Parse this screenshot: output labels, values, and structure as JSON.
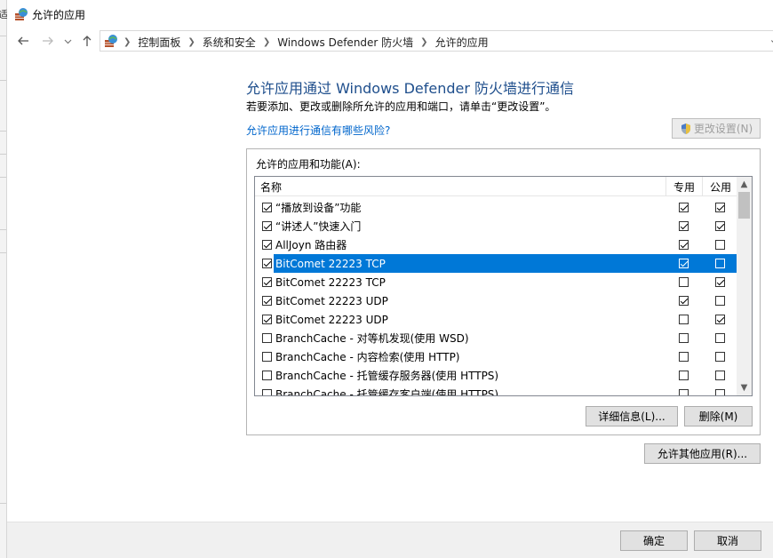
{
  "window": {
    "title": "允许的应用",
    "edge_char": "适"
  },
  "nav": {
    "back_icon": "arrow-left-icon",
    "forward_icon": "arrow-right-icon",
    "recent_icon": "chevron-down-icon",
    "up_icon": "arrow-up-icon"
  },
  "address": {
    "crumbs": [
      "控制面板",
      "系统和安全",
      "Windows Defender 防火墙",
      "允许的应用"
    ]
  },
  "page": {
    "heading": "允许应用通过 Windows Defender 防火墙进行通信",
    "description": "若要添加、更改或删除所允许的应用和端口，请单击“更改设置”。",
    "risk_link": "允许应用进行通信有哪些风险?",
    "change_settings_label": "更改设置(N)"
  },
  "apps": {
    "group_label": "允许的应用和功能(A):",
    "columns": {
      "name": "名称",
      "private": "专用",
      "public": "公用"
    },
    "rows": [
      {
        "name": "“播放到设备”功能",
        "enabled": true,
        "private": true,
        "public": true,
        "selected": false
      },
      {
        "name": "“讲述人”快速入门",
        "enabled": true,
        "private": true,
        "public": true,
        "selected": false
      },
      {
        "name": "AllJoyn 路由器",
        "enabled": true,
        "private": true,
        "public": false,
        "selected": false
      },
      {
        "name": "BitComet 22223 TCP",
        "enabled": true,
        "private": true,
        "public": false,
        "selected": true
      },
      {
        "name": "BitComet 22223 TCP",
        "enabled": true,
        "private": false,
        "public": true,
        "selected": false
      },
      {
        "name": "BitComet 22223 UDP",
        "enabled": true,
        "private": true,
        "public": false,
        "selected": false
      },
      {
        "name": "BitComet 22223 UDP",
        "enabled": true,
        "private": false,
        "public": true,
        "selected": false
      },
      {
        "name": "BranchCache - 对等机发现(使用 WSD)",
        "enabled": false,
        "private": false,
        "public": false,
        "selected": false
      },
      {
        "name": "BranchCache - 内容检索(使用 HTTP)",
        "enabled": false,
        "private": false,
        "public": false,
        "selected": false
      },
      {
        "name": "BranchCache - 托管缓存服务器(使用 HTTPS)",
        "enabled": false,
        "private": false,
        "public": false,
        "selected": false
      },
      {
        "name": "BranchCache - 托管缓存客户端(使用 HTTPS)",
        "enabled": false,
        "private": false,
        "public": false,
        "selected": false
      }
    ],
    "details_label": "详细信息(L)...",
    "delete_label": "删除(M)"
  },
  "allow_other_label": "允许其他应用(R)...",
  "ok_label": "确定",
  "cancel_label": "取消",
  "colors": {
    "heading": "#1e4e8c",
    "link": "#0066cc",
    "selection": "#0078d7"
  }
}
